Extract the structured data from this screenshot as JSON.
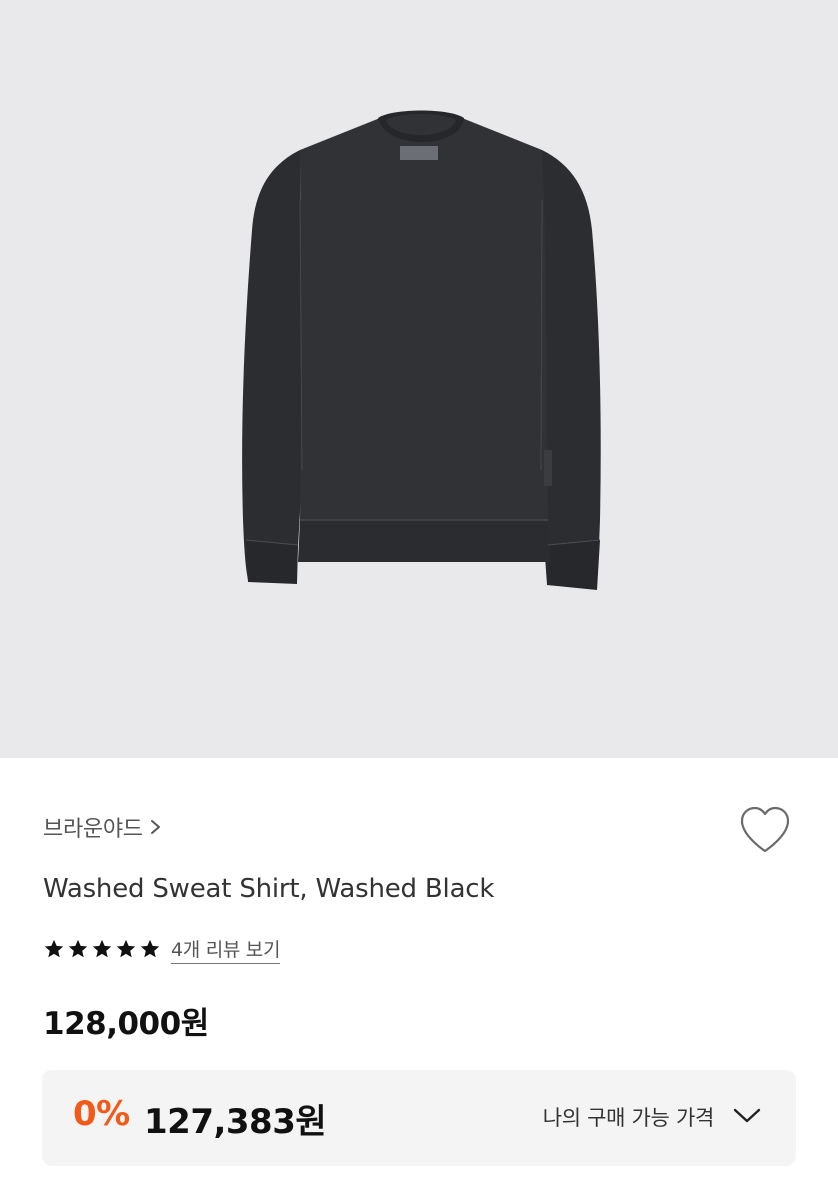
{
  "product": {
    "image_alt": "Washed Sweat Shirt in washed black, front view",
    "brand": "브라운야드",
    "name": "Washed Sweat Shirt, Washed Black",
    "rating_stars": 5,
    "review_link": "4개 리뷰 보기",
    "price": "128,000원",
    "discount_percent": "0%",
    "final_price": "127,383원",
    "my_price_label": "나의 구매 가능 가격"
  },
  "icons": {
    "brand_chevron": "chevron-right-icon",
    "wishlist": "heart-outline-icon",
    "star": "star-filled-icon",
    "expand": "chevron-down-icon"
  },
  "colors": {
    "hero_bg": "#e9e9ec",
    "discount": "#f25a1a",
    "promo_bg": "#f4f4f5",
    "garment": "#2f3134"
  }
}
